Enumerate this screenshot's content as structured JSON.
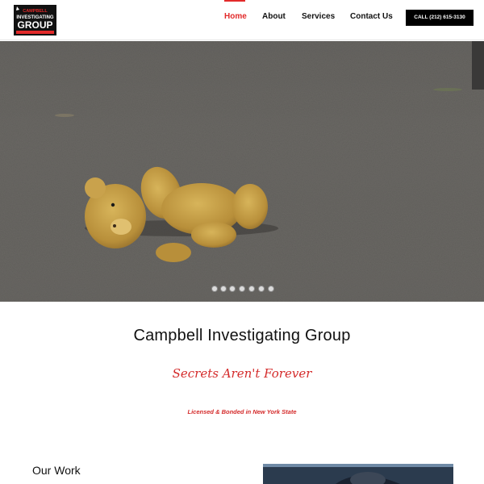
{
  "header": {
    "logo": {
      "line1": "CAMPBELL",
      "line2": "INVESTIGATING",
      "line3": "GROUP",
      "icon": "logo-badge"
    },
    "nav": [
      {
        "label": "Home",
        "active": true
      },
      {
        "label": "About",
        "active": false
      },
      {
        "label": "Services",
        "active": false
      },
      {
        "label": "Contact Us",
        "active": false
      }
    ],
    "call_button": "CALL (212) 615-3130"
  },
  "hero": {
    "image": "teddy-bear-on-asphalt-photo",
    "slide_count": 7,
    "active_slide": 1
  },
  "main": {
    "title": "Campbell Investigating Group",
    "tagline": "Secrets Aren't Forever",
    "licensed": "Licensed & Bonded in New York State"
  },
  "work": {
    "heading": "Our Work",
    "image": "car-window-photo"
  },
  "colors": {
    "accent": "#e22a2a",
    "text": "#111111",
    "button_bg": "#000000"
  }
}
